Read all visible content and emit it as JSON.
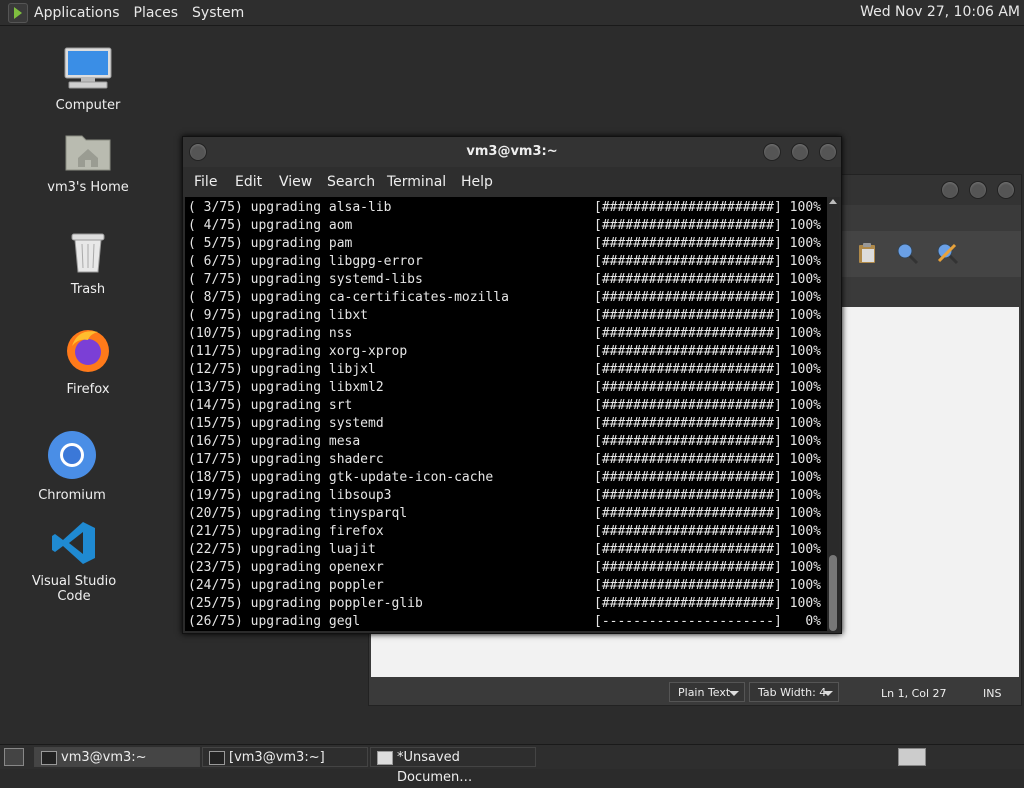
{
  "top_panel": {
    "menus": [
      "Applications",
      "Places",
      "System"
    ],
    "clock": "Wed Nov 27, 10:06 AM"
  },
  "desktop": {
    "icons": [
      {
        "label": "Computer",
        "icon": "computer-icon"
      },
      {
        "label": "vm3's Home",
        "icon": "home-folder-icon"
      },
      {
        "label": "Trash",
        "icon": "trash-icon"
      },
      {
        "label": "Firefox",
        "icon": "firefox-icon"
      },
      {
        "label": "Chromium",
        "icon": "chromium-icon"
      },
      {
        "label": "Visual Studio Code",
        "icon": "vscode-icon"
      }
    ]
  },
  "terminal": {
    "title": "vm3@vm3:~",
    "menu": [
      "File",
      "Edit",
      "View",
      "Search",
      "Terminal",
      "Help"
    ],
    "lines": [
      {
        "text": "( 3/75) upgrading alsa-lib",
        "bar": "[######################] 100%"
      },
      {
        "text": "( 4/75) upgrading aom",
        "bar": "[######################] 100%"
      },
      {
        "text": "( 5/75) upgrading pam",
        "bar": "[######################] 100%"
      },
      {
        "text": "( 6/75) upgrading libgpg-error",
        "bar": "[######################] 100%"
      },
      {
        "text": "( 7/75) upgrading systemd-libs",
        "bar": "[######################] 100%"
      },
      {
        "text": "( 8/75) upgrading ca-certificates-mozilla",
        "bar": "[######################] 100%"
      },
      {
        "text": "( 9/75) upgrading libxt",
        "bar": "[######################] 100%"
      },
      {
        "text": "(10/75) upgrading nss",
        "bar": "[######################] 100%"
      },
      {
        "text": "(11/75) upgrading xorg-xprop",
        "bar": "[######################] 100%"
      },
      {
        "text": "(12/75) upgrading libjxl",
        "bar": "[######################] 100%"
      },
      {
        "text": "(13/75) upgrading libxml2",
        "bar": "[######################] 100%"
      },
      {
        "text": "(14/75) upgrading srt",
        "bar": "[######################] 100%"
      },
      {
        "text": "(15/75) upgrading systemd",
        "bar": "[######################] 100%"
      },
      {
        "text": "(16/75) upgrading mesa",
        "bar": "[######################] 100%"
      },
      {
        "text": "(17/75) upgrading shaderc",
        "bar": "[######################] 100%"
      },
      {
        "text": "(18/75) upgrading gtk-update-icon-cache",
        "bar": "[######################] 100%"
      },
      {
        "text": "(19/75) upgrading libsoup3",
        "bar": "[######################] 100%"
      },
      {
        "text": "(20/75) upgrading tinysparql",
        "bar": "[######################] 100%"
      },
      {
        "text": "(21/75) upgrading firefox",
        "bar": "[######################] 100%"
      },
      {
        "text": "(22/75) upgrading luajit",
        "bar": "[######################] 100%"
      },
      {
        "text": "(23/75) upgrading openexr",
        "bar": "[######################] 100%"
      },
      {
        "text": "(24/75) upgrading poppler",
        "bar": "[######################] 100%"
      },
      {
        "text": "(25/75) upgrading poppler-glib",
        "bar": "[######################] 100%"
      },
      {
        "text": "(26/75) upgrading gegl",
        "bar": "[----------------------]   0%"
      }
    ]
  },
  "gedit": {
    "language": "Plain Text",
    "tab_width": "Tab Width:  4",
    "position": "Ln 1, Col 27",
    "mode": "INS",
    "toolbar_icons": [
      "paste-icon",
      "find-icon",
      "find-replace-icon"
    ]
  },
  "bottom_panel": {
    "tasks": [
      "vm3@vm3:~",
      "[vm3@vm3:~]",
      "*Unsaved Documen…"
    ]
  },
  "colors": {
    "panel": "#2e2e2e",
    "desktop": "#2c2c2c",
    "terminal_bg": "#000000"
  }
}
